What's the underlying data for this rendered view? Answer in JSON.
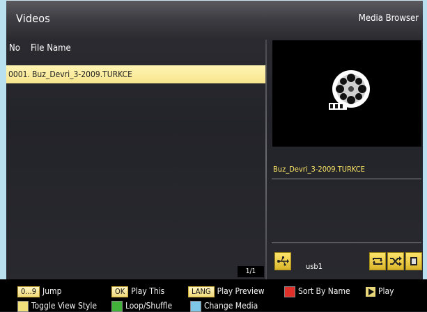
{
  "header": {
    "title": "Videos",
    "app_label": "Media Browser"
  },
  "list": {
    "col_no": "No",
    "col_name": "File Name",
    "rows": [
      {
        "no": "0001.",
        "name": "Buz_Devri_3-2009.TURKCE"
      }
    ]
  },
  "preview": {
    "icon": "film-reel-icon",
    "file_name": "Buz_Devri_3-2009.TURKCE"
  },
  "device": {
    "icon": "usb-icon",
    "label": "usb1"
  },
  "modes": {
    "icons": [
      "repeat-icon",
      "shuffle-icon",
      "stop-icon"
    ]
  },
  "pager": {
    "text": "1/1"
  },
  "footer": {
    "row1": [
      {
        "key": "0...9",
        "label": "Jump"
      },
      {
        "key": "OK",
        "label": "Play This"
      },
      {
        "key": "LANG",
        "label": "Play Preview"
      },
      {
        "key": "red",
        "label": "Sort By Name"
      },
      {
        "key": "play",
        "label": "Play"
      }
    ],
    "row2": [
      {
        "key": "yellow",
        "label": "Toggle View Style"
      },
      {
        "key": "green",
        "label": "Loop/Shuffle"
      },
      {
        "key": "blue",
        "label": "Change Media"
      }
    ]
  },
  "colors": {
    "selection": "#f7e58e",
    "accent_text": "#ffe866",
    "red_key": "#e0302a",
    "green_key": "#43b23a",
    "yellow_key": "#f2e07a",
    "blue_key": "#7fc7e8"
  }
}
